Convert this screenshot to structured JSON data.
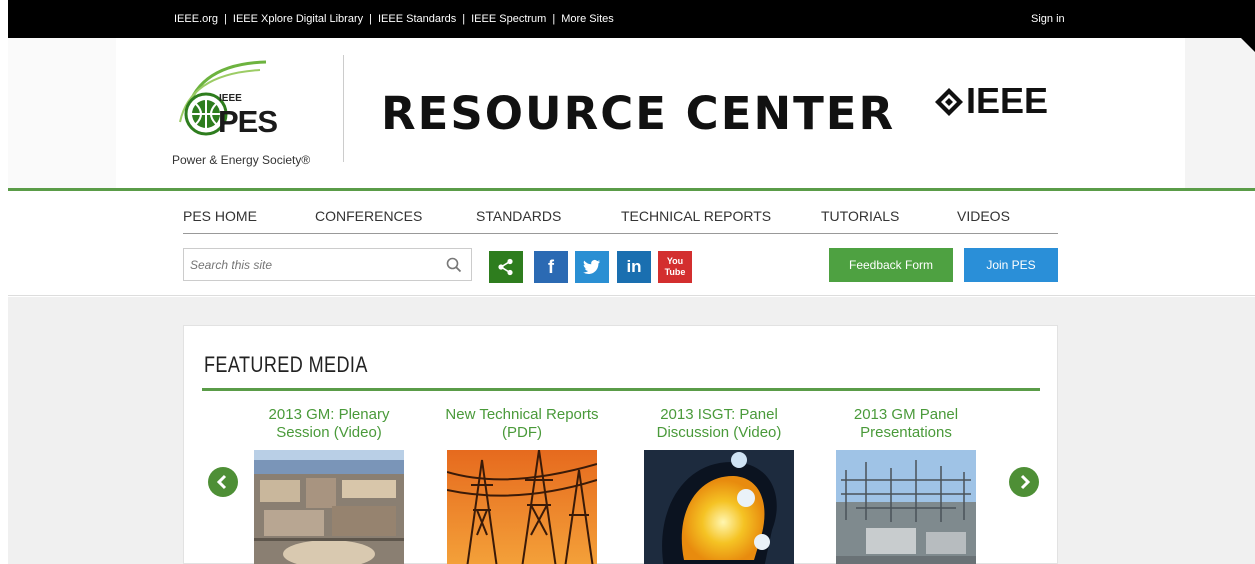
{
  "topbar": {
    "links": [
      "IEEE.org",
      "IEEE Xplore Digital Library",
      "IEEE Standards",
      "IEEE Spectrum",
      "More Sites"
    ],
    "signin": "Sign in"
  },
  "brand": {
    "ieee_small": "IEEE",
    "pes": "PES",
    "tagline": "Power & Energy Society®",
    "title": "RESOURCE CENTER",
    "ieee": "IEEE"
  },
  "nav": [
    "PES HOME",
    "CONFERENCES",
    "STANDARDS",
    "TECHNICAL REPORTS",
    "TUTORIALS",
    "VIDEOS"
  ],
  "search": {
    "placeholder": "Search this site"
  },
  "social": {
    "share": "share-icon",
    "facebook": "f",
    "twitter": "twitter-icon",
    "linkedin": "in",
    "youtube": "You Tube"
  },
  "buttons": {
    "feedback": "Feedback Form",
    "join": "Join PES"
  },
  "featured": {
    "heading": "FEATURED MEDIA",
    "items": [
      {
        "caption": "2013 GM: Plenary Session (Video)"
      },
      {
        "caption": "New Technical Reports (PDF)"
      },
      {
        "caption": "2013 ISGT: Panel Discussion (Video)"
      },
      {
        "caption": "2013 GM Panel Presentations"
      }
    ]
  },
  "colors": {
    "green": "#5a9c48",
    "dark_green": "#2e7d1e",
    "facebook": "#2b6ab3",
    "twitter": "#2a8fd3",
    "linkedin": "#1a6fb0",
    "youtube": "#d32f2f",
    "feedback": "#4ea141",
    "join": "#2a8fd8"
  }
}
